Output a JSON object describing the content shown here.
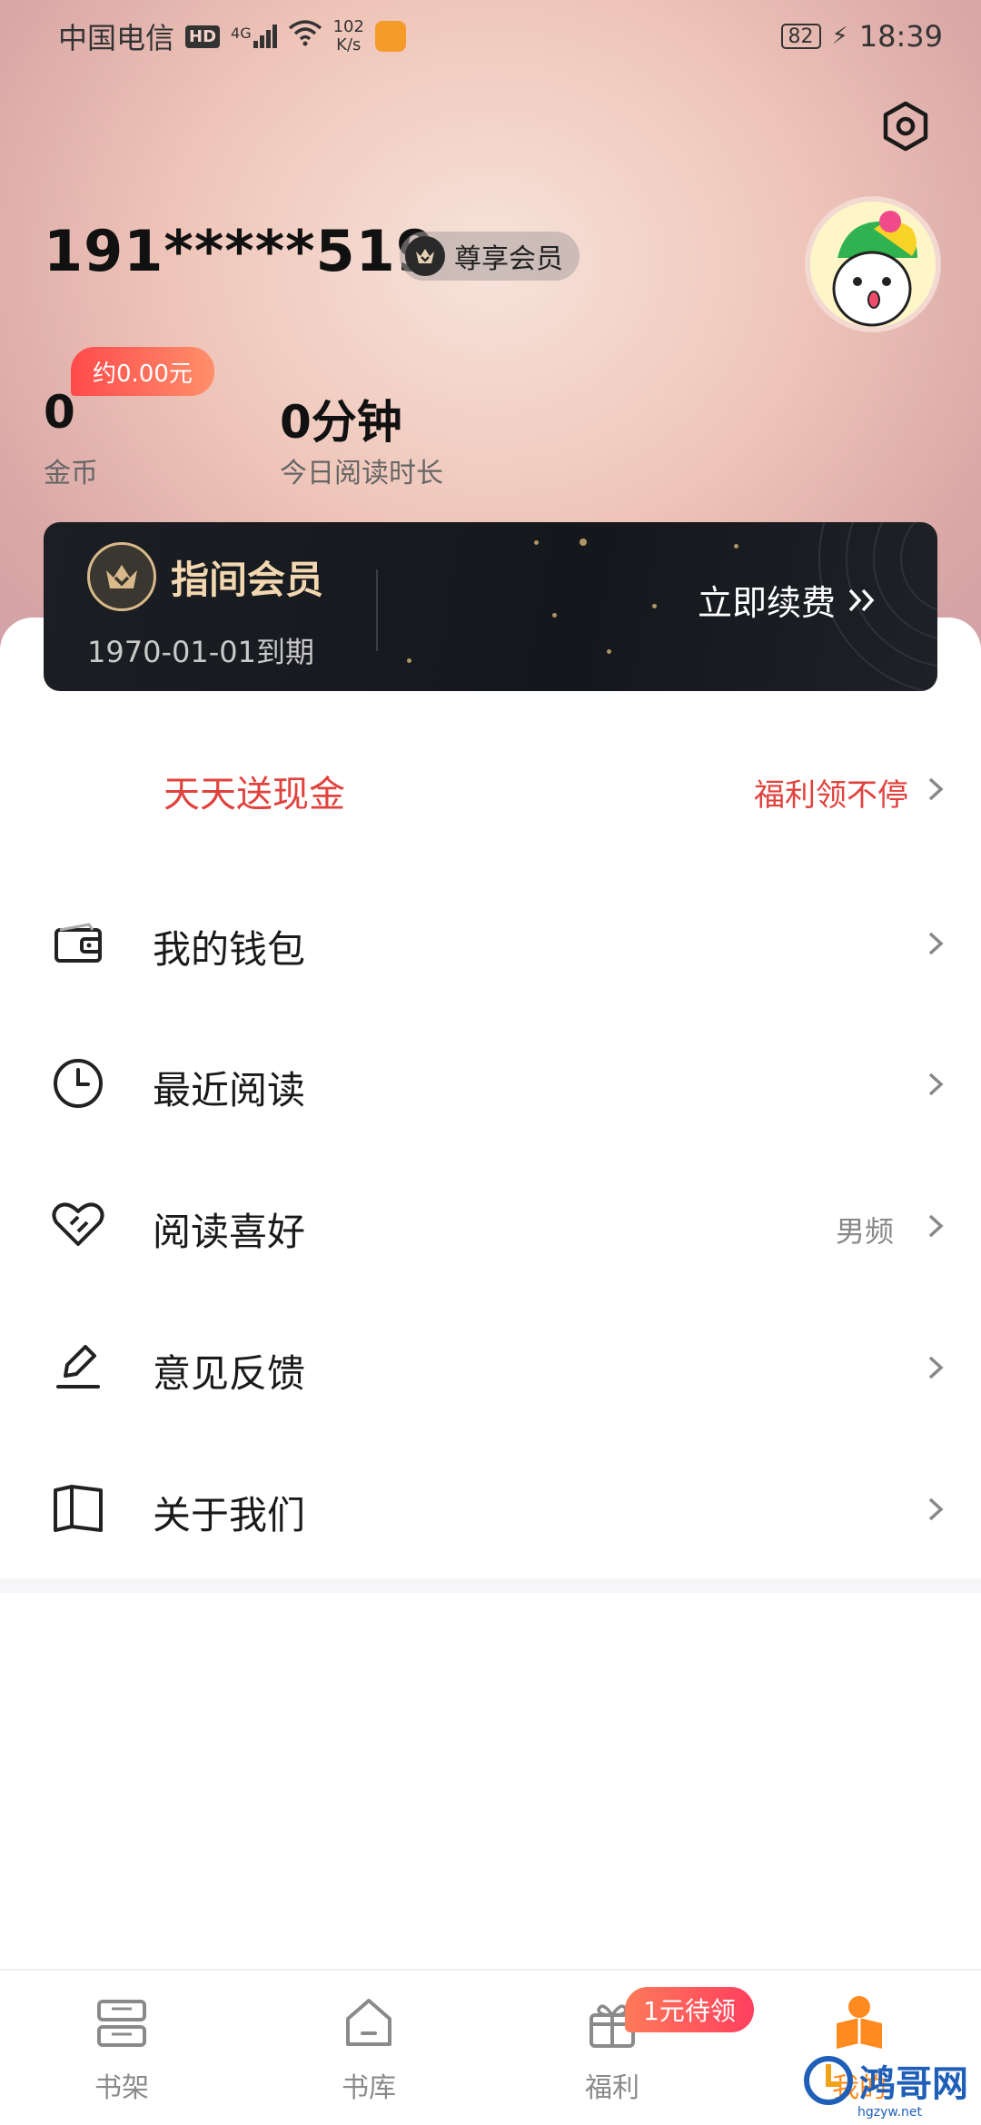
{
  "status_bar": {
    "carrier": "中国电信",
    "hd": "HD",
    "signal": "4G",
    "speed_value": "102",
    "speed_unit": "K/s",
    "battery": "82",
    "time": "18:39"
  },
  "profile": {
    "phone": "191*****519",
    "vip_label": "尊享会员"
  },
  "stats": {
    "coin_tip": "约0.00元",
    "coins_value": "0",
    "coins_label": "金币",
    "reading_value": "0分钟",
    "reading_label": "今日阅读时长"
  },
  "member_card": {
    "title": "指间会员",
    "expire": "1970-01-01到期",
    "renew_label": "立即续费"
  },
  "promo": {
    "left": "天天送现金",
    "right": "福利领不停"
  },
  "menu": [
    {
      "label": "我的钱包",
      "value": ""
    },
    {
      "label": "最近阅读",
      "value": ""
    },
    {
      "label": "阅读喜好",
      "value": "男频"
    },
    {
      "label": "意见反馈",
      "value": ""
    },
    {
      "label": "关于我们",
      "value": ""
    }
  ],
  "tabbar": {
    "tabs": [
      {
        "label": "书架"
      },
      {
        "label": "书库"
      },
      {
        "label": "福利"
      },
      {
        "label": "我的"
      }
    ],
    "badge": "1元待领"
  },
  "watermark": {
    "text": "鸿哥网",
    "sub": "hgzyw.net"
  },
  "colors": {
    "accent_red": "#e0433e",
    "member_gold": "#f2d7b0",
    "tab_active": "#ff8a1f"
  }
}
